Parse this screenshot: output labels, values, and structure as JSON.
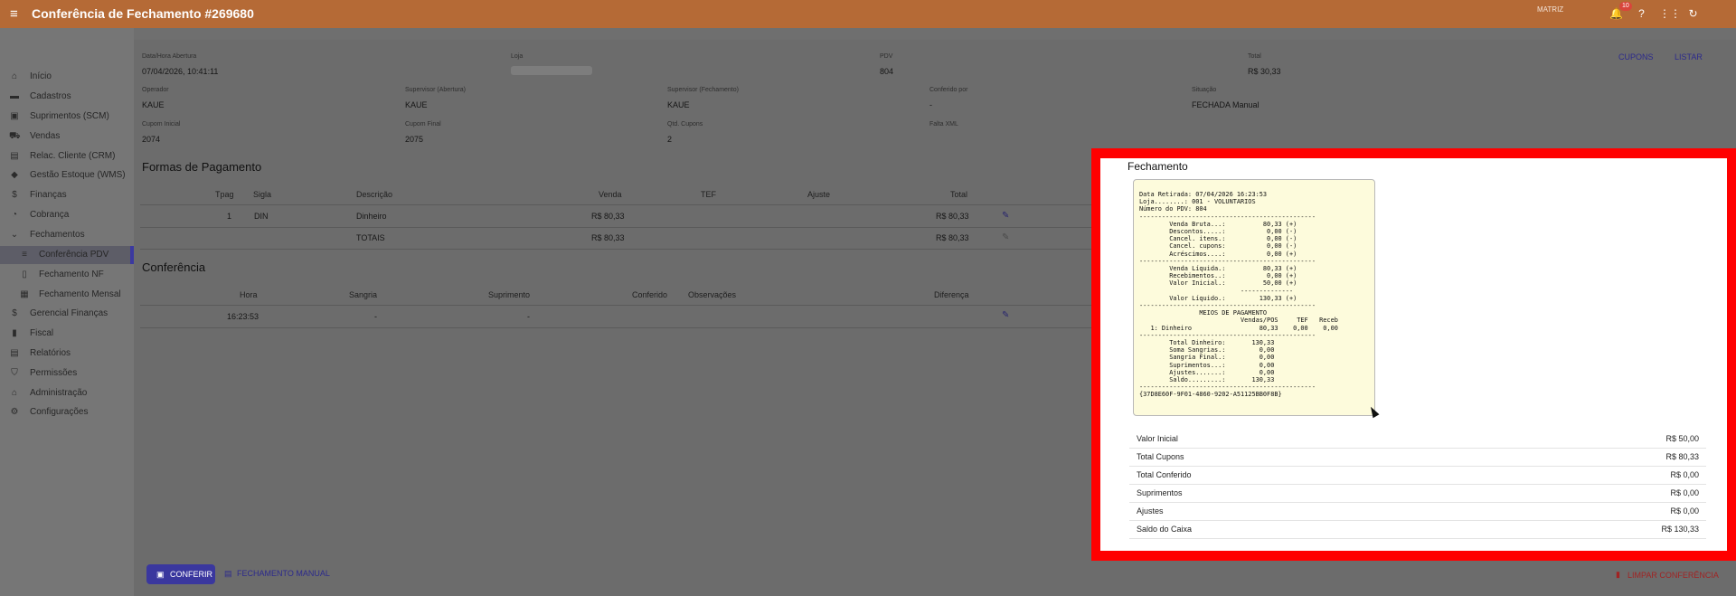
{
  "header": {
    "menu_icon": "hamburger-icon",
    "title": "Conferência de Fechamento #269680",
    "user": "MATRIZ",
    "notification_count": "10",
    "icons": [
      "bell-icon",
      "help-icon",
      "apps-icon",
      "refresh-icon"
    ]
  },
  "sidebar": {
    "items": [
      {
        "label": "Início",
        "icon": "home-icon"
      },
      {
        "label": "Cadastros",
        "icon": "folder-icon"
      },
      {
        "label": "Suprimentos (SCM)",
        "icon": "truck-icon"
      },
      {
        "label": "Vendas",
        "icon": "cart-icon"
      },
      {
        "label": "Relac. Cliente (CRM)",
        "icon": "contact-icon"
      },
      {
        "label": "Gestão Estoque (WMS)",
        "icon": "box-icon"
      },
      {
        "label": "Finanças",
        "icon": "dollar-icon"
      },
      {
        "label": "Cobrança",
        "icon": "pie-icon"
      },
      {
        "label": "Fechamentos",
        "icon": "chevron-down-icon"
      },
      {
        "label": "Conferência PDV",
        "icon": "list-icon"
      },
      {
        "label": "Fechamento NF",
        "icon": "document-icon"
      },
      {
        "label": "Fechamento Mensal",
        "icon": "calendar-icon"
      },
      {
        "label": "Gerencial Finanças",
        "icon": "dollar-icon"
      },
      {
        "label": "Fiscal",
        "icon": "book-icon"
      },
      {
        "label": "Relatórios",
        "icon": "report-icon"
      },
      {
        "label": "Permissões",
        "icon": "shield-icon"
      },
      {
        "label": "Administração",
        "icon": "bank-icon"
      },
      {
        "label": "Configurações",
        "icon": "gear-icon"
      }
    ]
  },
  "info": {
    "abertura_label": "Data/Hora Abertura",
    "abertura_value": "07/04/2026, 10:41:11",
    "loja_label": "Loja",
    "pdv_label": "PDV",
    "pdv_value": "804",
    "total_label": "Total",
    "total_value": "R$ 30,33",
    "operador_label": "Operador",
    "operador_value": "KAUE",
    "sup_abertura_label": "Supervisor (Abertura)",
    "sup_abertura_value": "KAUE",
    "sup_fechamento_label": "Supervisor (Fechamento)",
    "sup_fechamento_value": "KAUE",
    "conferido_label": "Conferido por",
    "conferido_value": "-",
    "situacao_label": "Situação",
    "situacao_value": "FECHADA Manual",
    "cupom_ini_label": "Cupom Inicial",
    "cupom_ini_value": "2074",
    "cupom_fim_label": "Cupom Final",
    "cupom_fim_value": "2075",
    "qtd_label": "Qtd. Cupons",
    "qtd_value": "2",
    "falta_label": "Falta XML",
    "cupons_link": "CUPONS",
    "listar_link": "LISTAR"
  },
  "formas": {
    "title": "Formas de Pagamento",
    "headers": [
      "Tpag",
      "Sigla",
      "Descrição",
      "Venda",
      "TEF",
      "Ajuste",
      "Total"
    ],
    "rows": [
      {
        "tpag": "1",
        "sigla": "DIN",
        "descricao": "Dinheiro",
        "venda": "R$ 80,33",
        "total": "R$ 80,33"
      },
      {
        "tpag": "",
        "sigla": "",
        "descricao": "TOTAIS",
        "venda": "R$ 80,33",
        "total": "R$ 80,33"
      }
    ]
  },
  "conferencia": {
    "title": "Conferência",
    "headers": [
      "Hora",
      "Sangria",
      "Suprimento",
      "Conferido",
      "Observações",
      "Diferença"
    ],
    "rows": [
      {
        "hora": "16:23:53",
        "sangria": "-",
        "suprimento": "-"
      }
    ]
  },
  "modal": {
    "title": "Fechamento",
    "receipt": "Data Retirada: 07/04/2026 16:23:53\nLoja........: 001 - VOLUNTARIOS\nNúmero do PDV: 804\n-----------------------------------------------\n        Venda Bruta...:          80,33 (+)\n        Descontos.....:           0,00 (-)\n        Cancel. itens.:           0,00 (-)\n        Cancel. cupons:           0,00 (-)\n        Acréscimos....:           0,00 (+)\n-----------------------------------------------\n        Venda Líquida.:          80,33 (+)\n        Recebimentos..:           0,00 (+)\n        Valor Inicial.:          50,00 (+)\n                           --------------\n        Valor Líquido.:         130,33 (+)\n-----------------------------------------------\n                MEIOS DE PAGAMENTO\n                           Vendas/POS     TEF   Receb\n   1: Dinheiro                  80,33    0,00    0,00\n-----------------------------------------------\n        Total Dinheiro:       130,33\n        Soma Sangrias.:         0,00\n        Sangria Final.:         0,00\n        Suprimentos...:         0,00\n        Ajustes.......:         0,00\n        Saldo.........:       130,33\n-----------------------------------------------\n{37D8E60F-9F01-4860-9202-A51125BB0F8B}",
    "summary": [
      {
        "label": "Valor Inicial",
        "value": "R$ 50,00"
      },
      {
        "label": "Total Cupons",
        "value": "R$ 80,33"
      },
      {
        "label": "Total Conferido",
        "value": "R$ 0,00"
      },
      {
        "label": "Suprimentos",
        "value": "R$ 0,00"
      },
      {
        "label": "Ajustes",
        "value": "R$ 0,00"
      },
      {
        "label": "Saldo do Caixa",
        "value": "R$ 130,33"
      }
    ]
  },
  "footer": {
    "conferir_label": "CONFERIR",
    "manual_label": "FECHAMENTO MANUAL",
    "limpar_label": "LIMPAR CONFERÊNCIA"
  },
  "colors": {
    "header": "#b56a36",
    "accent": "#3a379e",
    "highlight": "#ff0000"
  }
}
